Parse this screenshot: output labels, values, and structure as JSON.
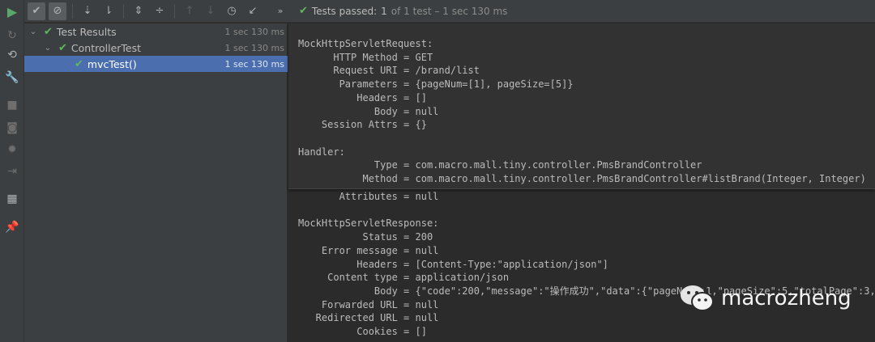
{
  "toolbar": {
    "status_prefix": "Tests passed:",
    "status_count": "1",
    "status_suffix": "of 1 test – 1 sec 130 ms",
    "more": "»"
  },
  "tree": [
    {
      "label": "Test Results",
      "time": "1 sec 130 ms",
      "level": 0,
      "selected": false
    },
    {
      "label": "ControllerTest",
      "time": "1 sec 130 ms",
      "level": 1,
      "selected": false
    },
    {
      "label": "mvcTest()",
      "time": "1 sec 130 ms",
      "level": 2,
      "selected": true
    }
  ],
  "console": {
    "overlay_text": "MockHttpServletRequest:\n      HTTP Method = GET\n      Request URI = /brand/list\n       Parameters = {pageNum=[1], pageSize=[5]}\n          Headers = []\n             Body = null\n    Session Attrs = {}\n\nHandler:\n             Type = com.macro.mall.tiny.controller.PmsBrandController\n           Method = com.macro.mall.tiny.controller.PmsBrandController#listBrand(Integer, Integer)",
    "lower_text": "       Attributes = null\n\nMockHttpServletResponse:\n           Status = 200\n    Error message = null\n          Headers = [Content-Type:\"application/json\"]\n     Content type = application/json\n             Body = {\"code\":200,\"message\":\"操作成功\",\"data\":{\"pageNum\":1,\"pageSize\":5,\"totalPage\":3,\n    Forwarded URL = null\n   Redirected URL = null\n          Cookies = []"
  },
  "watermark": "macrozheng",
  "colors": {
    "pass": "#5fb85f",
    "selection": "#4b6eaf"
  }
}
